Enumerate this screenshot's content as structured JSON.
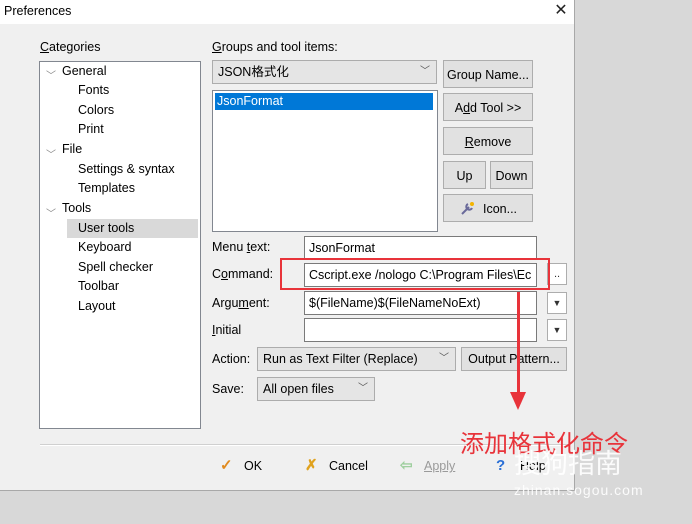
{
  "window": {
    "title": "Preferences",
    "close_glyph": "✕"
  },
  "categories": {
    "label_u": "C",
    "label_rest": "ategories",
    "items": [
      {
        "label": "General",
        "expanded": true
      },
      {
        "label": "Fonts"
      },
      {
        "label": "Colors"
      },
      {
        "label": "Print"
      },
      {
        "label": "File",
        "expanded": true
      },
      {
        "label": "Settings & syntax"
      },
      {
        "label": "Templates"
      },
      {
        "label": "Tools",
        "expanded": true
      },
      {
        "label": "User tools",
        "selected": true
      },
      {
        "label": "Keyboard"
      },
      {
        "label": "Spell checker"
      },
      {
        "label": "Toolbar"
      },
      {
        "label": "Layout"
      }
    ]
  },
  "groups": {
    "label_u": "G",
    "label_rest": "roups and tool items:",
    "selected_group": "JSON格式化",
    "items": [
      {
        "label": "JsonFormat",
        "selected": true
      }
    ],
    "buttons": {
      "group_name": "Group Name...",
      "add_tool_pre": "A",
      "add_tool_u": "d",
      "add_tool_post": "d Tool >>",
      "remove_u": "R",
      "remove_rest": "emove",
      "up": "Up",
      "down": "Down",
      "icon": "Icon..."
    }
  },
  "form": {
    "menu_text_label_pre": "Menu ",
    "menu_text_label_u": "t",
    "menu_text_label_post": "ext:",
    "menu_text_value": "JsonFormat",
    "command_label_pre": "C",
    "command_label_u": "o",
    "command_label_post": "mmand:",
    "command_value": "Cscript.exe /nologo C:\\Program Files\\Ec",
    "command_browse": "..",
    "argument_label_pre": "Argu",
    "argument_label_u": "m",
    "argument_label_post": "ent:",
    "argument_value": "$(FileName)$(FileNameNoExt)",
    "initial_label_u": "I",
    "initial_label_rest": "nitial",
    "initial_value": "",
    "action_label": "Action:",
    "action_value": "Run as Text Filter (Replace)",
    "output_pattern": "Output Pattern...",
    "save_label": "Save:",
    "save_value": "All open files"
  },
  "footer": {
    "ok": "OK",
    "cancel": "Cancel",
    "apply": "Apply",
    "help": "Help"
  },
  "annotation": {
    "text": "添加格式化命令",
    "watermark": "搜狗指南",
    "watermark_url": "zhinan.sogou.com"
  },
  "colors": {
    "annotation_red": "#e8333a",
    "selection_blue": "#0078d7"
  }
}
